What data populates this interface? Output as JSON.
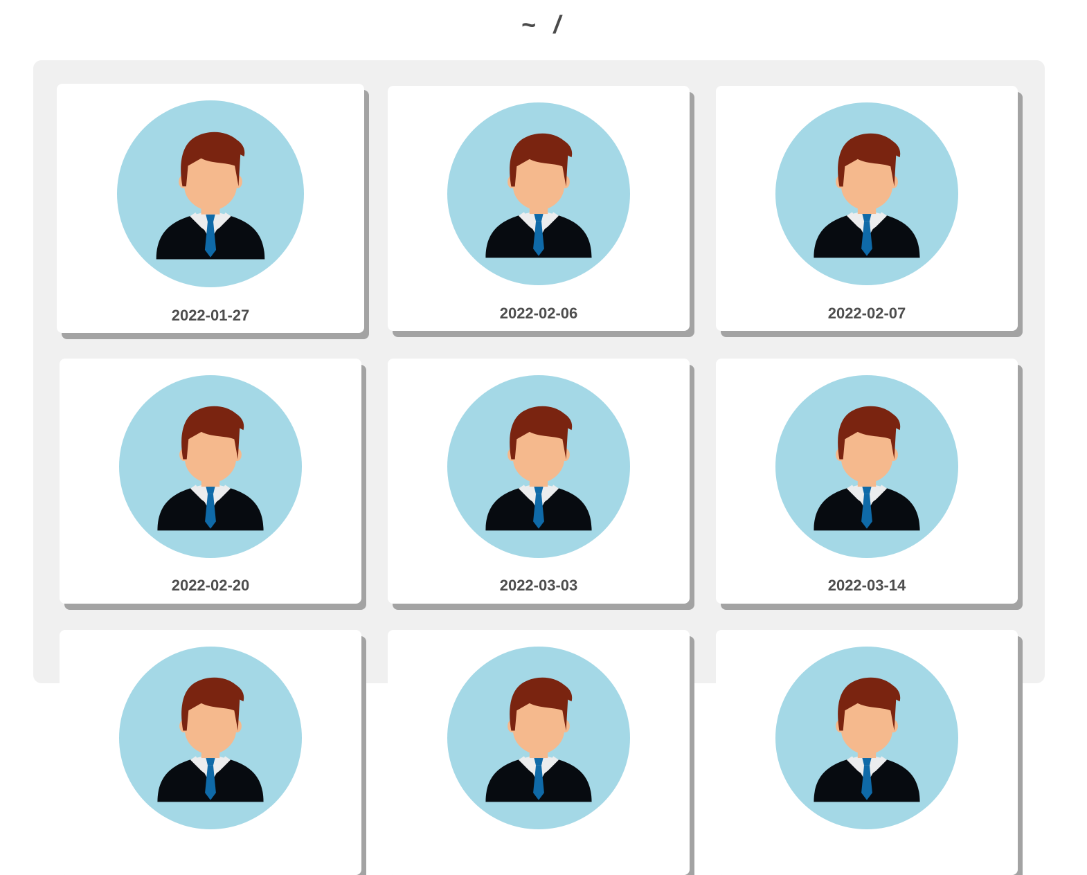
{
  "header": {
    "title": "~ /"
  },
  "gallery": {
    "items": [
      {
        "date": "2022-01-27",
        "icon": "avatar-icon"
      },
      {
        "date": "2022-02-06",
        "icon": "avatar-icon"
      },
      {
        "date": "2022-02-07",
        "icon": "avatar-icon"
      },
      {
        "date": "2022-02-20",
        "icon": "avatar-icon"
      },
      {
        "date": "2022-03-03",
        "icon": "avatar-icon"
      },
      {
        "date": "2022-03-14",
        "icon": "avatar-icon"
      }
    ]
  },
  "colors": {
    "avatar_background": "#a4d8e6",
    "hair": "#7a2410",
    "skin": "#f5b98d",
    "suit": "#070b10",
    "shirt": "#ecedee",
    "tie": "#0f6aa8"
  }
}
